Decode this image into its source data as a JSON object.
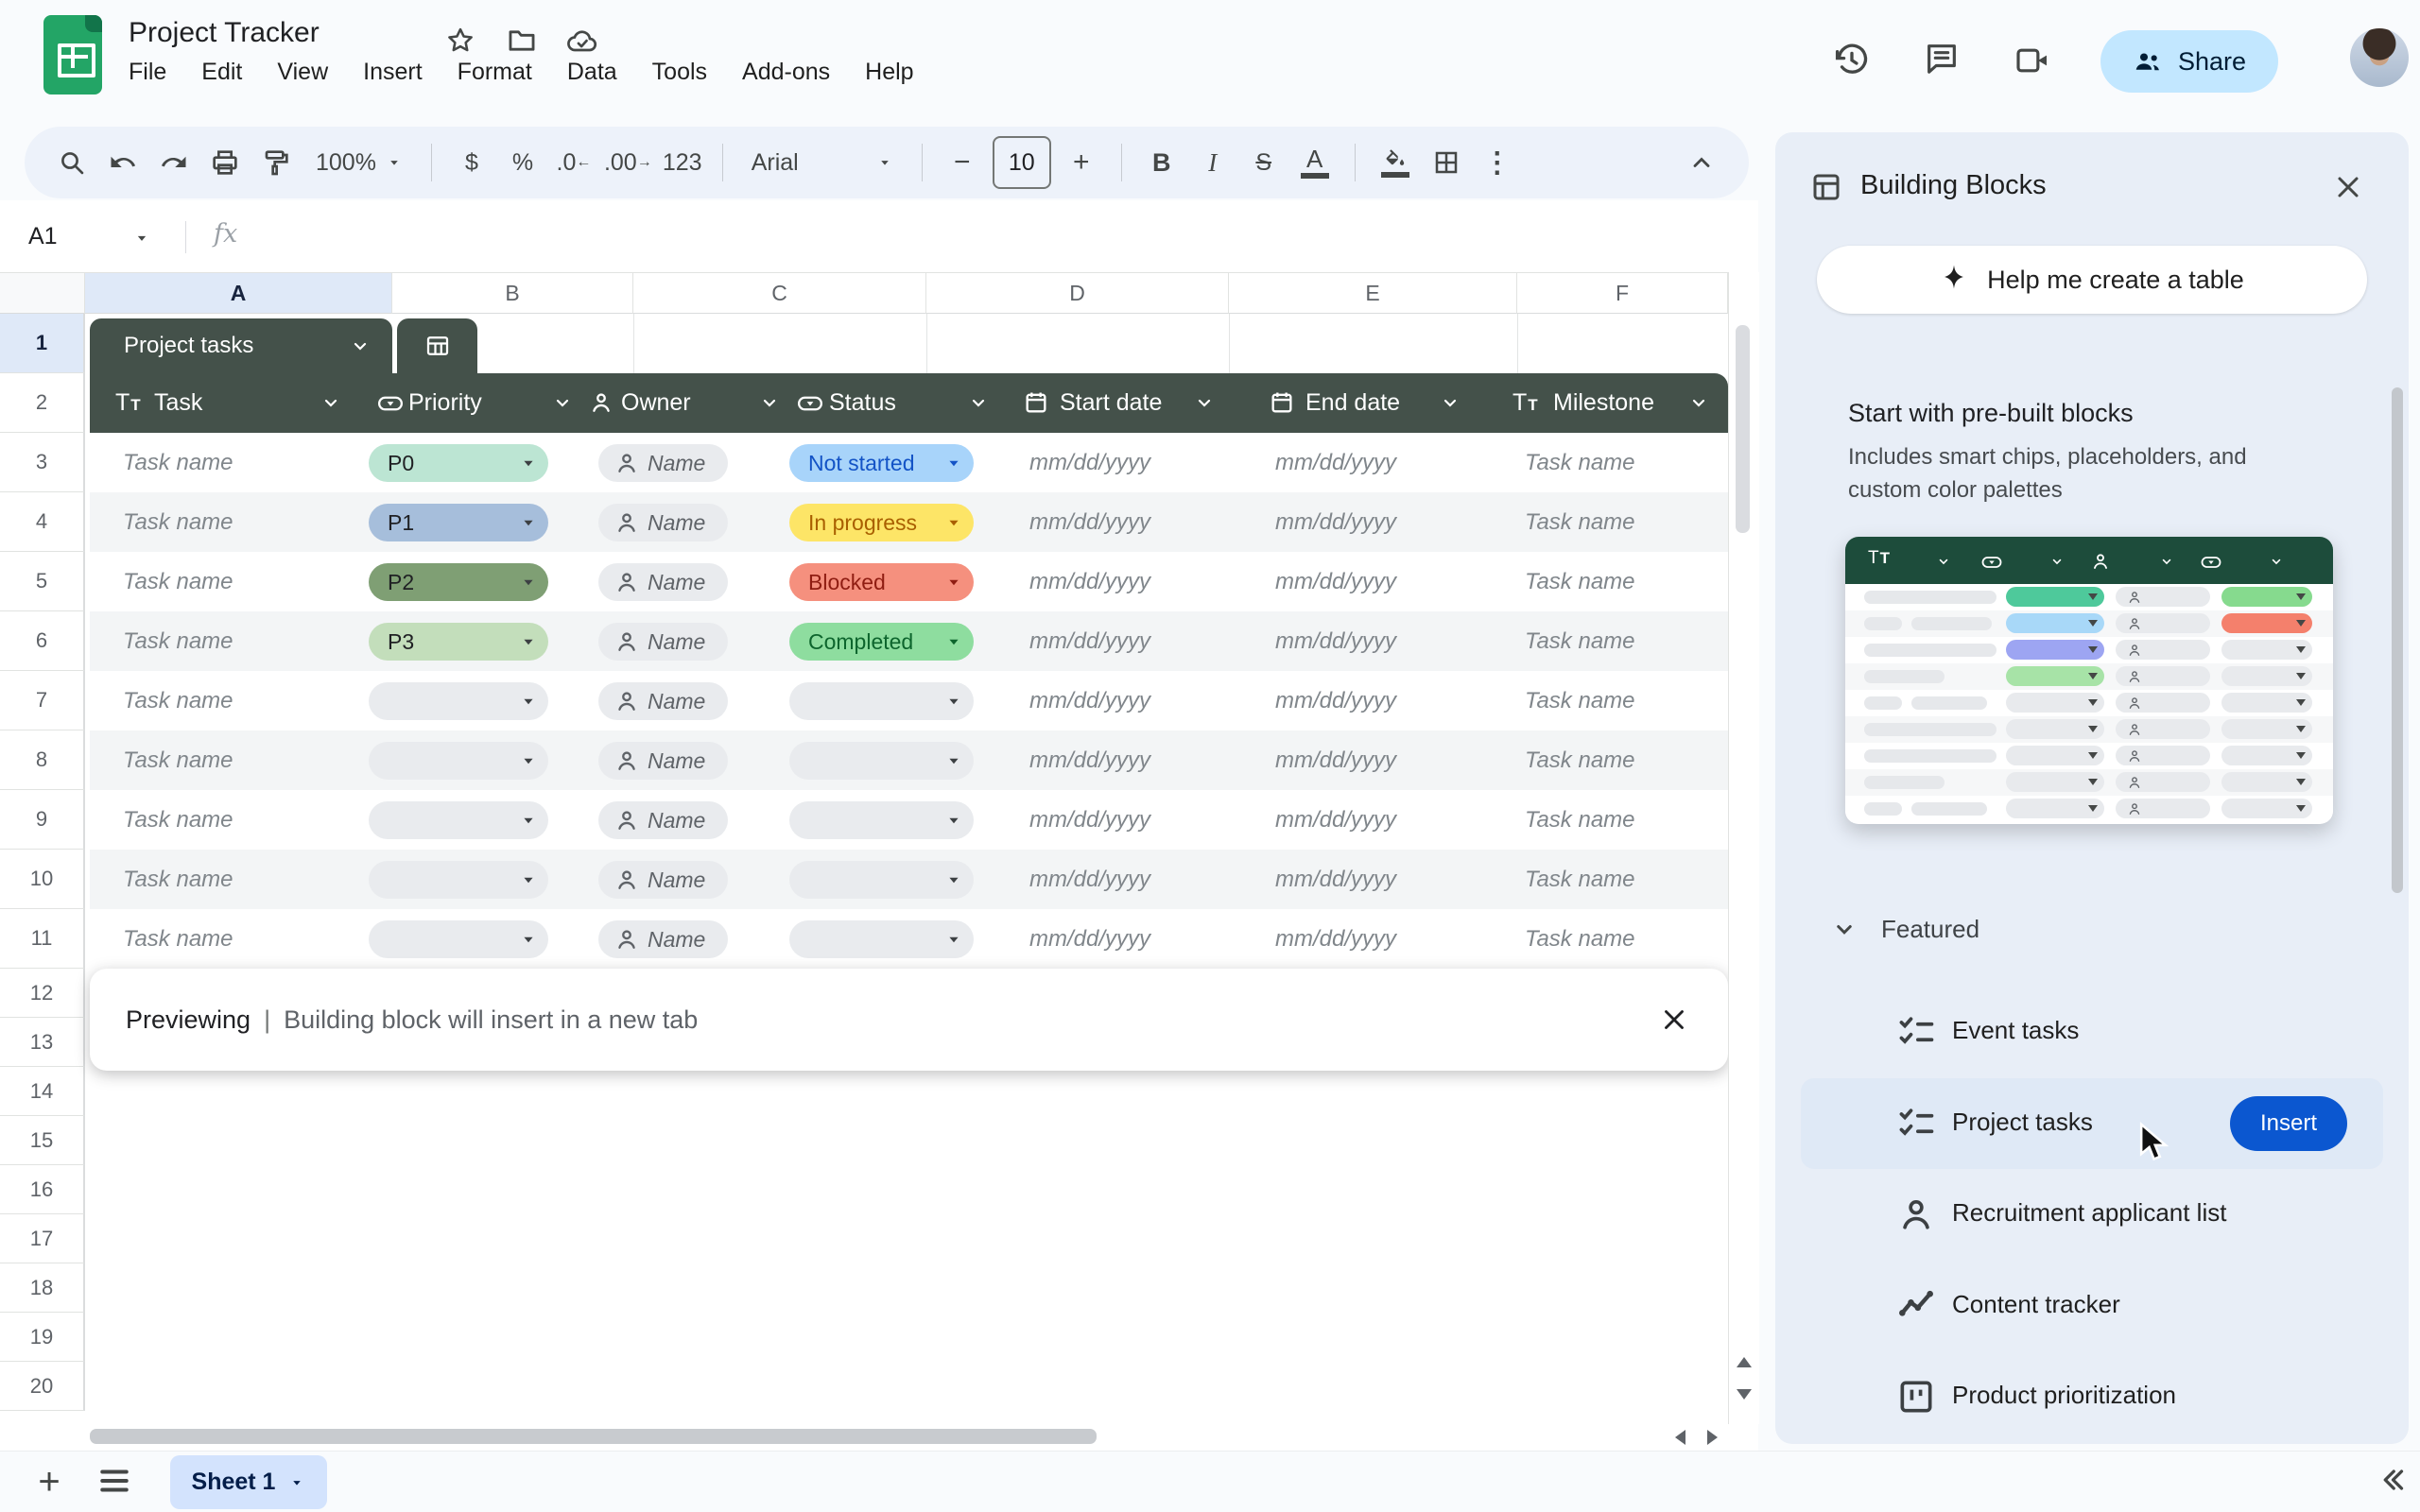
{
  "app": {
    "title": "Project Tracker",
    "menus": [
      "File",
      "Edit",
      "View",
      "Insert",
      "Format",
      "Data",
      "Tools",
      "Add-ons",
      "Help"
    ],
    "share_label": "Share"
  },
  "toolbar": {
    "zoom": "100%",
    "currency": "$",
    "percent": "%",
    "decimal_decrease": ".0",
    "decimal_increase": ".00",
    "number_format": "123",
    "font_name": "Arial",
    "font_size": "10",
    "bold": "B",
    "italic": "I",
    "strikethrough": "S",
    "text_color": "A"
  },
  "formula_bar": {
    "name_box": "A1",
    "fx_label": "fx"
  },
  "grid": {
    "selected_cell": "A1",
    "column_letters": [
      "A",
      "B",
      "C",
      "D",
      "E",
      "F"
    ],
    "row_numbers": [
      "1",
      "2",
      "3",
      "4",
      "5",
      "6",
      "7",
      "8",
      "9",
      "10",
      "11",
      "12",
      "13",
      "14",
      "15",
      "16",
      "17",
      "18",
      "19",
      "20"
    ]
  },
  "table": {
    "tab_label": "Project tasks",
    "header_green": "#44514a",
    "columns": [
      {
        "label": "Task",
        "icon": "text-icon"
      },
      {
        "label": "Priority",
        "icon": "dropdown-icon"
      },
      {
        "label": "Owner",
        "icon": "person-icon"
      },
      {
        "label": "Status",
        "icon": "dropdown-icon"
      },
      {
        "label": "Start date",
        "icon": "calendar-icon"
      },
      {
        "label": "End date",
        "icon": "calendar-icon"
      },
      {
        "label": "Milestone",
        "icon": "text-icon"
      }
    ],
    "rows": [
      {
        "task": "Task name",
        "priority": "P0",
        "priority_color": "#bce5d3",
        "owner": "Name",
        "status": "Not started",
        "status_color": "#a8d4fa",
        "status_text_color": "#1353c6",
        "start": "mm/dd/yyyy",
        "end": "mm/dd/yyyy",
        "milestone": "Task name"
      },
      {
        "task": "Task name",
        "priority": "P1",
        "priority_color": "#a6bedb",
        "owner": "Name",
        "status": "In progress",
        "status_color": "#fde567",
        "status_text_color": "#a95f00",
        "start": "mm/dd/yyyy",
        "end": "mm/dd/yyyy",
        "milestone": "Task name"
      },
      {
        "task": "Task name",
        "priority": "P2",
        "priority_color": "#7f9f74",
        "owner": "Name",
        "status": "Blocked",
        "status_color": "#f5907e",
        "status_text_color": "#8f1d12",
        "start": "mm/dd/yyyy",
        "end": "mm/dd/yyyy",
        "milestone": "Task name"
      },
      {
        "task": "Task name",
        "priority": "P3",
        "priority_color": "#c3debb",
        "owner": "Name",
        "status": "Completed",
        "status_color": "#8edd9f",
        "status_text_color": "#0d652d",
        "start": "mm/dd/yyyy",
        "end": "mm/dd/yyyy",
        "milestone": "Task name"
      },
      {
        "task": "Task name",
        "priority": "",
        "priority_color": "#e9ebee",
        "owner": "Name",
        "status": "",
        "status_color": "#e9ebee",
        "status_text_color": "#3c4043",
        "start": "mm/dd/yyyy",
        "end": "mm/dd/yyyy",
        "milestone": "Task name"
      },
      {
        "task": "Task name",
        "priority": "",
        "priority_color": "#e9ebee",
        "owner": "Name",
        "status": "",
        "status_color": "#e9ebee",
        "status_text_color": "#3c4043",
        "start": "mm/dd/yyyy",
        "end": "mm/dd/yyyy",
        "milestone": "Task name"
      },
      {
        "task": "Task name",
        "priority": "",
        "priority_color": "#e9ebee",
        "owner": "Name",
        "status": "",
        "status_color": "#e9ebee",
        "status_text_color": "#3c4043",
        "start": "mm/dd/yyyy",
        "end": "mm/dd/yyyy",
        "milestone": "Task name"
      },
      {
        "task": "Task name",
        "priority": "",
        "priority_color": "#e9ebee",
        "owner": "Name",
        "status": "",
        "status_color": "#e9ebee",
        "status_text_color": "#3c4043",
        "start": "mm/dd/yyyy",
        "end": "mm/dd/yyyy",
        "milestone": "Task name"
      },
      {
        "task": "Task name",
        "priority": "",
        "priority_color": "#e9ebee",
        "owner": "Name",
        "status": "",
        "status_color": "#e9ebee",
        "status_text_color": "#3c4043",
        "start": "mm/dd/yyyy",
        "end": "mm/dd/yyyy",
        "milestone": "Task name"
      }
    ]
  },
  "preview_banner": {
    "status": "Previewing",
    "separator": "|",
    "message": "Building block will insert in a new tab"
  },
  "sheet_bar": {
    "active_tab": "Sheet 1"
  },
  "sidebar": {
    "title": "Building Blocks",
    "help_button_label": "Help me create a table",
    "section_heading": "Start with pre-built blocks",
    "section_subheading_line1": "Includes smart chips, placeholders, and",
    "section_subheading_line2": "custom color palettes",
    "featured_heading": "Featured",
    "items": [
      {
        "label": "Event tasks",
        "icon": "checklist-icon",
        "hovered": false
      },
      {
        "label": "Project tasks",
        "icon": "checklist-icon",
        "hovered": true,
        "action_label": "Insert"
      },
      {
        "label": "Recruitment applicant list",
        "icon": "person-icon",
        "hovered": false
      },
      {
        "label": "Content tracker",
        "icon": "chart-icon",
        "hovered": false
      },
      {
        "label": "Product prioritization",
        "icon": "kanban-icon",
        "hovered": false
      }
    ],
    "mini_preview": {
      "header_green": "#1d4c3b",
      "header_chips": [
        "text",
        "dropdown",
        "person",
        "dropdown"
      ],
      "rows": [
        {
          "bars": [
            140
          ],
          "chip1": "#4ec99b",
          "chip2": "#86da8e"
        },
        {
          "bars": [
            40,
            85
          ],
          "chip1": "#a8d8f8",
          "chip2": "#f4806c"
        },
        {
          "bars": [
            140
          ],
          "chip1": "#9da5f2",
          "chip2": "#e8eaed"
        },
        {
          "bars": [
            85
          ],
          "chip1": "#a7e3a7",
          "chip2": "#e8eaed"
        },
        {
          "bars": [
            40,
            80
          ],
          "chip1": "#e8eaed",
          "chip2": "#e8eaed"
        },
        {
          "bars": [
            140
          ],
          "chip1": "#e8eaed",
          "chip2": "#e8eaed"
        },
        {
          "bars": [
            140
          ],
          "chip1": "#e8eaed",
          "chip2": "#e8eaed"
        },
        {
          "bars": [
            85
          ],
          "chip1": "#e8eaed",
          "chip2": "#e8eaed"
        },
        {
          "bars": [
            40,
            80
          ],
          "chip1": "#e8eaed",
          "chip2": "#e8eaed"
        }
      ]
    }
  }
}
